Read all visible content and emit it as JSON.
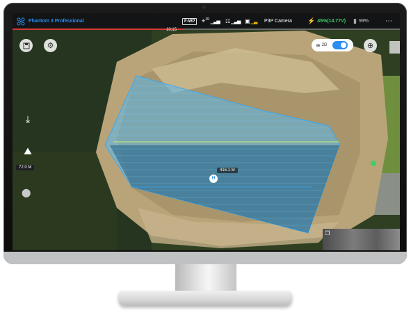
{
  "app": {
    "title": "Phantom 3 Professional",
    "time": "10:15",
    "mode": "F-WP",
    "gps_count": "19",
    "camera_label": "P3P Camera",
    "battery": "45%(14.77V)",
    "rc_battery": "99%",
    "view_mode": "2D"
  },
  "map": {
    "altitude": "72.0 M",
    "area_label": "416.1 M",
    "aircraft_marker": "H"
  },
  "colors": {
    "accent": "#2b8cf3",
    "brand": "#1e6fd0",
    "battery_green": "#3ecf66",
    "alert_red": "#d83b33",
    "polygon_fill": "#57b8f0"
  },
  "icons": [
    "drone-logo-icon",
    "gps-icon",
    "rc-signal-icon",
    "video-signal-icon",
    "camera-icon",
    "battery-icon",
    "rc-battery-icon",
    "menu-icon",
    "save-icon",
    "settings-icon",
    "takeoff-icon",
    "landing-icon",
    "location-pin-icon",
    "locate-icon",
    "map-layers-icon"
  ]
}
